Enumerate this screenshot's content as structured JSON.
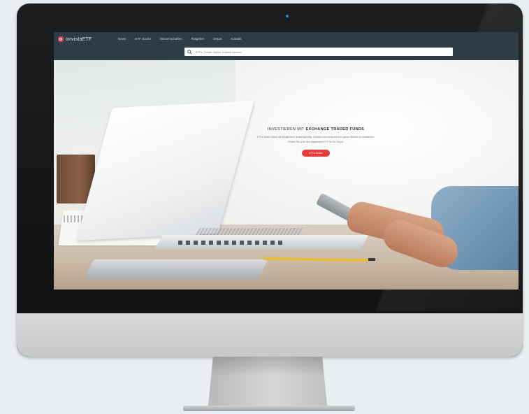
{
  "logo": {
    "text": "onvistaETF"
  },
  "nav": {
    "items": [
      "News",
      "ETF-Suche",
      "Wissenschaften",
      "Ratgeber",
      "Depot",
      "Kontakt"
    ]
  },
  "search": {
    "placeholder": "ETFs, Fonds, Aktien, Indizes suchen..."
  },
  "hero": {
    "title_lead": "INVESTIEREN MIT",
    "title_strong": "EXCHANGE TRADED FUNDS",
    "text": "ETFs bieten Ihnen die Möglichkeit, kostengünstig, einfach und transparent in ganze Märkte zu investieren. Finden Sie jetzt den passenden ETF für Ihr Depot.",
    "cta_label": "ETFs finden"
  },
  "colors": {
    "navbar": "#2d3c47",
    "accent": "#e4324b",
    "cta": "#e43b3b"
  }
}
